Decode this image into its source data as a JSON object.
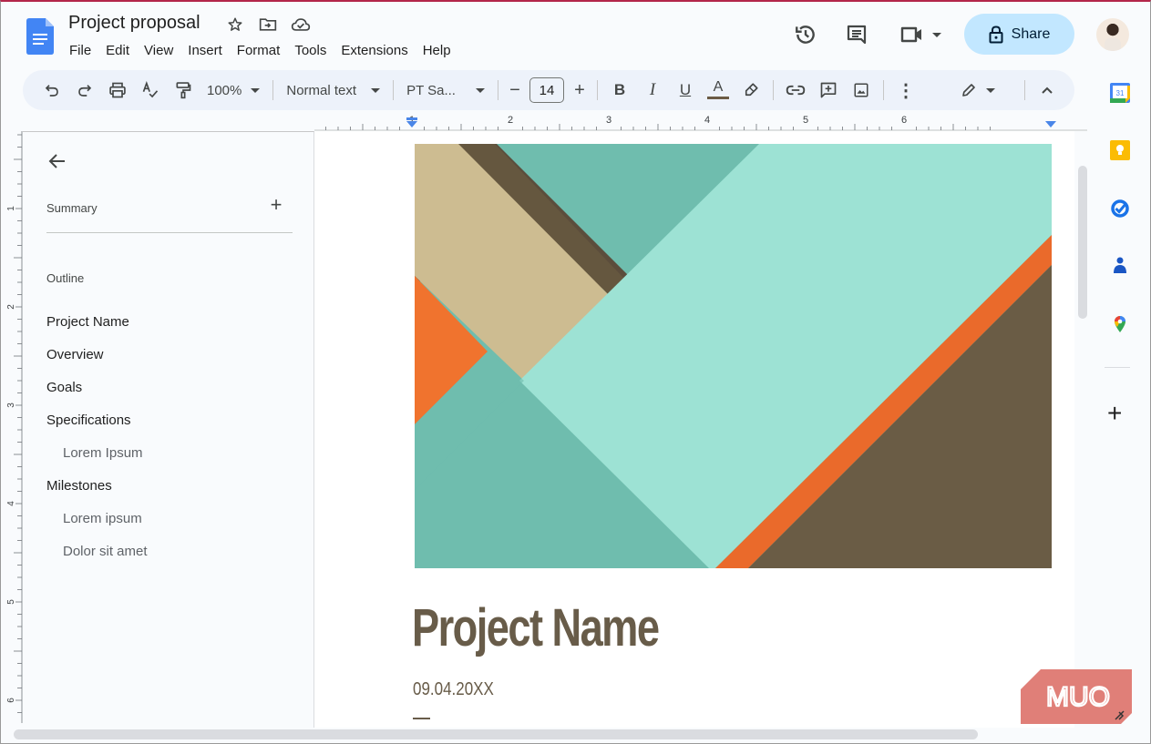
{
  "app": {
    "doc_title": "Project proposal",
    "menu": [
      "File",
      "Edit",
      "View",
      "Insert",
      "Format",
      "Tools",
      "Extensions",
      "Help"
    ],
    "share_label": "Share"
  },
  "toolbar": {
    "zoom": "100%",
    "style": "Normal text",
    "font": "PT Sa...",
    "font_size": "14",
    "text_color": "#6b5b45"
  },
  "ruler": {
    "horizontal_labels": [
      "1",
      "1",
      "2",
      "3",
      "4",
      "5",
      "6"
    ],
    "vertical_labels": [
      "1",
      "2",
      "3",
      "4",
      "5",
      "6"
    ]
  },
  "sidebar": {
    "summary_label": "Summary",
    "outline_label": "Outline",
    "outline": [
      {
        "label": "Project Name",
        "level": 1
      },
      {
        "label": "Overview",
        "level": 1
      },
      {
        "label": "Goals",
        "level": 1
      },
      {
        "label": "Specifications",
        "level": 1
      },
      {
        "label": "Lorem Ipsum",
        "level": 2
      },
      {
        "label": "Milestones",
        "level": 1
      },
      {
        "label": "Lorem ipsum",
        "level": 2
      },
      {
        "label": "Dolor sit amet",
        "level": 2
      }
    ]
  },
  "document": {
    "title": "Project Name",
    "date": "09.04.20XX",
    "title_color": "#685c49"
  },
  "side_panel": {
    "apps": [
      "Calendar",
      "Keep",
      "Tasks",
      "Contacts",
      "Maps"
    ],
    "calendar_day": "31"
  },
  "watermark": {
    "text": "MUO",
    "color": "#e07f78"
  },
  "colors": {
    "share_bg": "#c2e7ff",
    "toolbar_bg": "#edf2fa",
    "docs_blue": "#4285f4"
  }
}
